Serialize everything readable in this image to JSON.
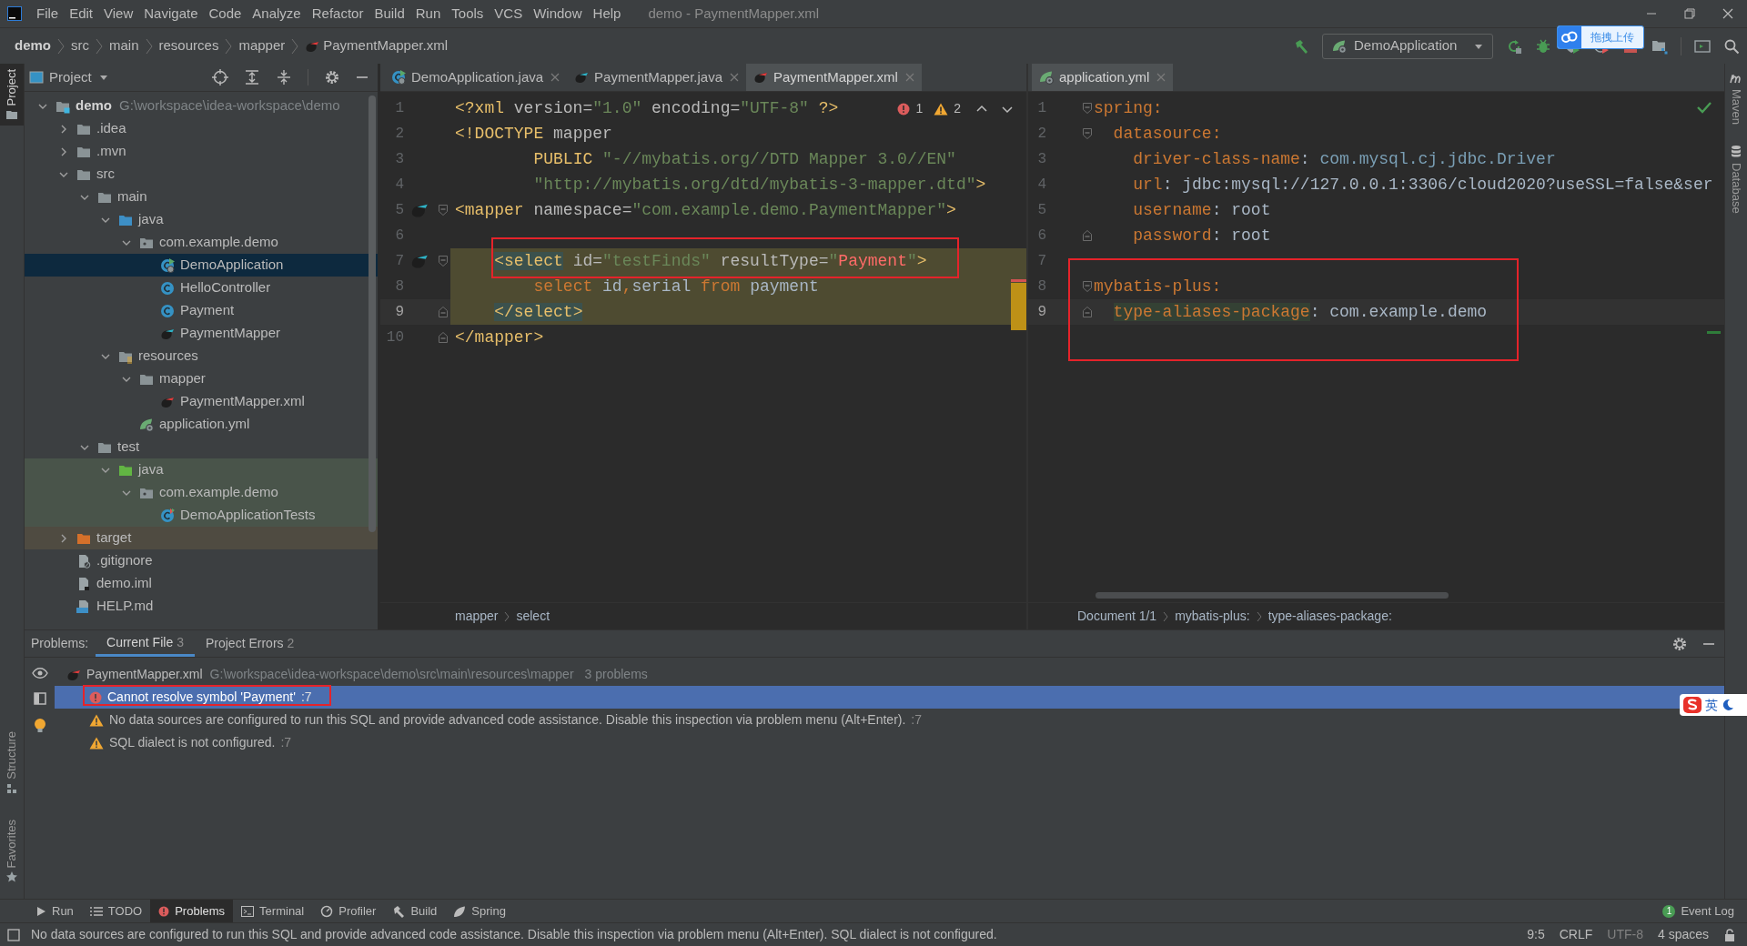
{
  "menu_bar": {
    "items": [
      "File",
      "Edit",
      "View",
      "Navigate",
      "Code",
      "Analyze",
      "Refactor",
      "Build",
      "Run",
      "Tools",
      "VCS",
      "Window",
      "Help"
    ],
    "title": "demo - PaymentMapper.xml"
  },
  "nav_bar": {
    "breadcrumbs": [
      {
        "label": "demo",
        "kind": "project"
      },
      {
        "label": "src",
        "kind": "folder"
      },
      {
        "label": "main",
        "kind": "folder"
      },
      {
        "label": "resources",
        "kind": "folder"
      },
      {
        "label": "mapper",
        "kind": "folder"
      },
      {
        "label": "PaymentMapper.xml",
        "kind": "mapper-xml"
      }
    ],
    "run_config": "DemoApplication"
  },
  "upload_widget": {
    "label": "拖拽上传"
  },
  "left_tool_strip": [
    {
      "label": "Project",
      "selected": true
    },
    {
      "label": "Structure",
      "selected": false
    },
    {
      "label": "Favorites",
      "selected": false
    }
  ],
  "right_tool_strip": [
    {
      "label": "Maven",
      "kind": "maven"
    },
    {
      "label": "Database",
      "kind": "database"
    }
  ],
  "project_panel": {
    "title": "Project",
    "tree": [
      {
        "label": "demo",
        "kind": "module",
        "hint": "G:\\workspace\\idea-workspace\\demo",
        "expanded": true,
        "selected": false,
        "children": [
          {
            "label": ".idea",
            "kind": "folder",
            "expanded": false,
            "selected": false
          },
          {
            "label": ".mvn",
            "kind": "folder",
            "expanded": false,
            "selected": false
          },
          {
            "label": "src",
            "kind": "folder",
            "expanded": true,
            "selected": false,
            "children": [
              {
                "label": "main",
                "kind": "folder",
                "expanded": true,
                "selected": false,
                "children": [
                  {
                    "label": "java",
                    "kind": "source-folder",
                    "expanded": true,
                    "selected": false,
                    "children": [
                      {
                        "label": "com.example.demo",
                        "kind": "package",
                        "expanded": true,
                        "selected": false,
                        "children": [
                          {
                            "label": "DemoApplication",
                            "kind": "spring-class",
                            "selected": true
                          },
                          {
                            "label": "HelloController",
                            "kind": "class",
                            "selected": false
                          },
                          {
                            "label": "Payment",
                            "kind": "class",
                            "selected": false
                          },
                          {
                            "label": "PaymentMapper",
                            "kind": "mapper",
                            "selected": false
                          }
                        ]
                      }
                    ]
                  },
                  {
                    "label": "resources",
                    "kind": "resources-folder",
                    "expanded": true,
                    "selected": false,
                    "children": [
                      {
                        "label": "mapper",
                        "kind": "folder",
                        "expanded": true,
                        "selected": false,
                        "children": [
                          {
                            "label": "PaymentMapper.xml",
                            "kind": "mapper-xml",
                            "selected": false
                          }
                        ]
                      },
                      {
                        "label": "application.yml",
                        "kind": "spring-yml",
                        "selected": false
                      }
                    ]
                  }
                ]
              },
              {
                "label": "test",
                "kind": "folder",
                "expanded": true,
                "selected": false,
                "children": [
                  {
                    "label": "java",
                    "kind": "test-folder",
                    "expanded": true,
                    "selected": false,
                    "children": [
                      {
                        "label": "com.example.demo",
                        "kind": "test-package",
                        "expanded": true,
                        "selected": false,
                        "children": [
                          {
                            "label": "DemoApplicationTests",
                            "kind": "test-class",
                            "selected": false
                          }
                        ]
                      }
                    ]
                  }
                ]
              }
            ]
          },
          {
            "label": "target",
            "kind": "excluded-folder",
            "expanded": false,
            "selected": false
          },
          {
            "label": ".gitignore",
            "kind": "ignore-file",
            "selected": false
          },
          {
            "label": "demo.iml",
            "kind": "iml-file",
            "selected": false
          },
          {
            "label": "HELP.md",
            "kind": "md-file",
            "selected": false
          }
        ]
      }
    ]
  },
  "editors": [
    {
      "tabs": [
        {
          "label": "DemoApplication.java",
          "kind": "spring-class",
          "selected": false
        },
        {
          "label": "PaymentMapper.java",
          "kind": "mapper",
          "selected": false
        },
        {
          "label": "PaymentMapper.xml",
          "kind": "mapper-xml",
          "selected": true
        }
      ],
      "inspection": {
        "errors": "1",
        "warnings": "2"
      },
      "lines": [
        {
          "number": "1",
          "current": false,
          "highlighted": false,
          "gutter_marker": false,
          "fold_start": false,
          "fold_end": false,
          "segments": [
            {
              "kind": "tag",
              "s": "<?xml "
            },
            {
              "kind": "attr",
              "s": "version="
            },
            {
              "kind": "str",
              "s": "\"1.0\" "
            },
            {
              "kind": "attr",
              "s": "encoding="
            },
            {
              "kind": "str",
              "s": "\"UTF-8\""
            },
            {
              "kind": "tag",
              "s": " ?>"
            }
          ]
        },
        {
          "number": "2",
          "current": false,
          "highlighted": false,
          "gutter_marker": false,
          "fold_start": false,
          "fold_end": false,
          "segments": [
            {
              "kind": "tag",
              "s": "<!DOCTYPE "
            },
            {
              "kind": "attr",
              "s": "mapper"
            }
          ]
        },
        {
          "number": "3",
          "current": false,
          "highlighted": false,
          "gutter_marker": false,
          "fold_start": false,
          "fold_end": false,
          "segments": [
            {
              "kind": "tag",
              "s": "        PUBLIC "
            },
            {
              "kind": "str",
              "s": "\"-//mybatis.org//DTD Mapper 3.0//EN\""
            }
          ]
        },
        {
          "number": "4",
          "current": false,
          "highlighted": false,
          "gutter_marker": false,
          "fold_start": false,
          "fold_end": false,
          "segments": [
            {
              "kind": "str",
              "s": "        \"http://mybatis.org/dtd/mybatis-3-mapper.dtd\""
            },
            {
              "kind": "tag",
              "s": ">"
            }
          ]
        },
        {
          "number": "5",
          "current": false,
          "highlighted": false,
          "gutter_marker": true,
          "fold_start": true,
          "fold_end": false,
          "segments": [
            {
              "kind": "tag",
              "s": "<mapper "
            },
            {
              "kind": "attr",
              "s": "namespace="
            },
            {
              "kind": "str",
              "s": "\"com.example.demo.PaymentMapper\""
            },
            {
              "kind": "tag",
              "s": ">"
            }
          ]
        },
        {
          "number": "6",
          "current": false,
          "highlighted": false,
          "gutter_marker": false,
          "fold_start": false,
          "fold_end": false
        },
        {
          "number": "7",
          "current": false,
          "highlighted": true,
          "gutter_marker": true,
          "fold_start": true,
          "fold_end": false,
          "segments": [
            {
              "kind": "tag_paired",
              "s": "    <select"
            },
            {
              "kind": "attr",
              "s": " id="
            },
            {
              "kind": "str",
              "s": "\"testFinds\" "
            },
            {
              "kind": "attr",
              "s": "resultType="
            },
            {
              "kind": "str",
              "s": "\""
            },
            {
              "kind": "err",
              "s": "Payment"
            },
            {
              "kind": "str",
              "s": "\""
            },
            {
              "kind": "tag",
              "s": ">"
            }
          ]
        },
        {
          "number": "8",
          "current": false,
          "highlighted": true,
          "gutter_marker": false,
          "fold_start": false,
          "fold_end": false,
          "segments": [
            {
              "kind": "kw",
              "s": "        select"
            },
            {
              "kind": "plain",
              "s": " id"
            },
            {
              "kind": "kw",
              "s": ","
            },
            {
              "kind": "plain",
              "s": "serial "
            },
            {
              "kind": "kw",
              "s": "from"
            },
            {
              "kind": "plain",
              "s": " payment"
            }
          ]
        },
        {
          "number": "9",
          "current": true,
          "highlighted": true,
          "gutter_marker": false,
          "fold_start": false,
          "fold_end": true,
          "segments": [
            {
              "kind": "tag_paired",
              "s": "    </select>"
            }
          ]
        },
        {
          "number": "10",
          "current": false,
          "highlighted": false,
          "gutter_marker": false,
          "fold_start": false,
          "fold_end": true,
          "segments": [
            {
              "kind": "tag",
              "s": "</mapper>"
            }
          ]
        }
      ],
      "breadcrumbs": [
        "mapper",
        "select"
      ]
    },
    {
      "tabs": [
        {
          "label": "application.yml",
          "kind": "spring-yml",
          "selected": true
        }
      ],
      "lines": [
        {
          "number": "1",
          "current": false,
          "highlighted": false,
          "gutter_marker": false,
          "fold_start": true,
          "fold_end": false,
          "segments": [
            {
              "kind": "key",
              "s": "spring:"
            }
          ]
        },
        {
          "number": "2",
          "current": false,
          "highlighted": false,
          "gutter_marker": false,
          "fold_start": true,
          "fold_end": false,
          "segments": [
            {
              "kind": "key",
              "s": "  datasource:"
            }
          ]
        },
        {
          "number": "3",
          "current": false,
          "highlighted": false,
          "gutter_marker": false,
          "fold_start": false,
          "fold_end": false,
          "segments": [
            {
              "kind": "key",
              "s": "    driver-class-name"
            },
            {
              "kind": "plain",
              "s": ": "
            },
            {
              "kind": "cls",
              "s": "com.mysql.cj.jdbc.Driver"
            }
          ]
        },
        {
          "number": "4",
          "current": false,
          "highlighted": false,
          "gutter_marker": false,
          "fold_start": false,
          "fold_end": false,
          "segments": [
            {
              "kind": "key",
              "s": "    url"
            },
            {
              "kind": "plain",
              "s": ": jdbc:mysql://127.0.0.1:3306/cloud2020?useSSL=false&ser"
            }
          ]
        },
        {
          "number": "5",
          "current": false,
          "highlighted": false,
          "gutter_marker": false,
          "fold_start": false,
          "fold_end": false,
          "segments": [
            {
              "kind": "key",
              "s": "    username"
            },
            {
              "kind": "plain",
              "s": ": root"
            }
          ]
        },
        {
          "number": "6",
          "current": false,
          "highlighted": false,
          "gutter_marker": false,
          "fold_start": false,
          "fold_end": true,
          "segments": [
            {
              "kind": "key",
              "s": "    password"
            },
            {
              "kind": "plain",
              "s": ": root"
            }
          ]
        },
        {
          "number": "7",
          "current": false,
          "highlighted": false,
          "gutter_marker": false,
          "fold_start": false,
          "fold_end": false
        },
        {
          "number": "8",
          "current": false,
          "highlighted": false,
          "gutter_marker": false,
          "fold_start": true,
          "fold_end": false,
          "segments": [
            {
              "kind": "key",
              "s": "mybatis-plus:"
            }
          ]
        },
        {
          "number": "9",
          "current": true,
          "highlighted": false,
          "gutter_marker": false,
          "fold_start": false,
          "fold_end": true,
          "segments": [
            {
              "kind": "key_paired",
              "s": "  type-aliases-package"
            },
            {
              "kind": "plain",
              "s": ": com.example.demo"
            }
          ]
        }
      ],
      "breadcrumbs": [
        "Document 1/1",
        "mybatis-plus:",
        "type-aliases-package:"
      ]
    }
  ],
  "problems": {
    "title": "Problems:",
    "tabs": [
      {
        "label": "Current File",
        "count": "3",
        "selected": true
      },
      {
        "label": "Project Errors",
        "count": "2",
        "selected": false
      }
    ],
    "file": {
      "name": "PaymentMapper.xml",
      "path": "G:\\workspace\\idea-workspace\\demo\\src\\main\\resources\\mapper",
      "summary": "3 problems"
    },
    "items": [
      {
        "kind": "error",
        "text": "Cannot resolve symbol 'Payment'",
        "line": ":7",
        "selected": true
      },
      {
        "kind": "warning",
        "text": "No data sources are configured to run this SQL and provide advanced code assistance. Disable this inspection via problem menu (Alt+Enter).",
        "line": ":7",
        "selected": false
      },
      {
        "kind": "warning",
        "text": "SQL dialect is not configured.",
        "line": ":7",
        "selected": false
      }
    ]
  },
  "tool_bar": [
    {
      "label": "Run",
      "kind": "run",
      "selected": false
    },
    {
      "label": "TODO",
      "kind": "todo",
      "selected": false
    },
    {
      "label": "Problems",
      "kind": "problems",
      "selected": true
    },
    {
      "label": "Terminal",
      "kind": "terminal",
      "selected": false
    },
    {
      "label": "Profiler",
      "kind": "profiler",
      "selected": false
    },
    {
      "label": "Build",
      "kind": "build",
      "selected": false
    },
    {
      "label": "Spring",
      "kind": "spring",
      "selected": false
    }
  ],
  "event_log": {
    "label": "Event Log",
    "badge": "1"
  },
  "status_bar": {
    "message": "No data sources are configured to run this SQL and provide advanced code assistance. Disable this inspection via problem menu (Alt+Enter). SQL dialect is not configured.",
    "position": "9:5",
    "line_separator": "CRLF",
    "encoding": "UTF-8",
    "indent": "4 spaces"
  },
  "ime_indicator": {
    "label": "英"
  }
}
